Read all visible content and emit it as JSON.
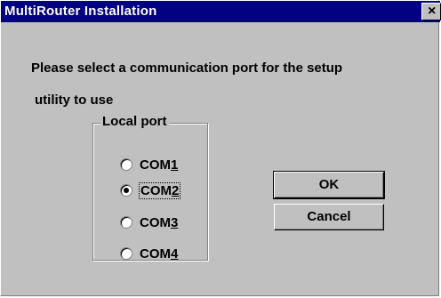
{
  "window": {
    "title": "MultiRouter Installation",
    "close_label": "×"
  },
  "prompt": {
    "line1": "Please select a communication port for the setup",
    "line2": "utility to use"
  },
  "group": {
    "label": "Local port",
    "options": [
      {
        "prefix": "COM",
        "accel": "1",
        "selected": false
      },
      {
        "prefix": "COM",
        "accel": "2",
        "selected": true
      },
      {
        "prefix": "COM",
        "accel": "3",
        "selected": false
      },
      {
        "prefix": "COM",
        "accel": "4",
        "selected": false
      }
    ]
  },
  "buttons": {
    "ok_label": "OK",
    "cancel_label": "Cancel"
  }
}
